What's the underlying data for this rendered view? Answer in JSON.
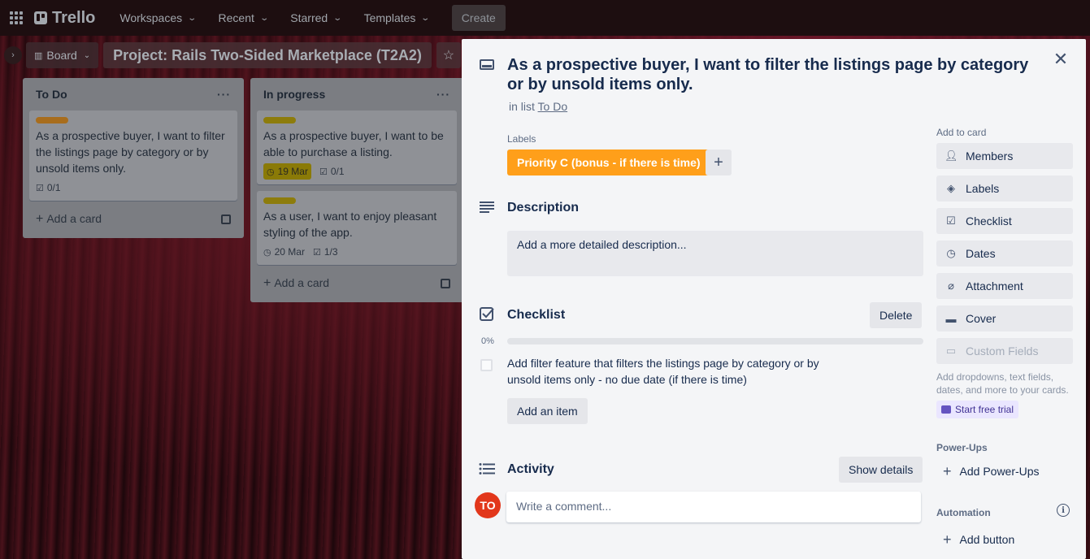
{
  "topnav": {
    "logo": "Trello",
    "items": [
      {
        "label": "Workspaces"
      },
      {
        "label": "Recent"
      },
      {
        "label": "Starred"
      },
      {
        "label": "Templates"
      }
    ],
    "create": "Create"
  },
  "boardbar": {
    "view": "Board",
    "title": "Project: Rails Two-Sided Marketplace (T2A2)"
  },
  "lists": [
    {
      "title": "To Do",
      "menu": "···",
      "cards": [
        {
          "label_color": "#d29034",
          "title": "As a prospective buyer, I want to filter the listings page by category or by unsold items only.",
          "checklist": "0/1"
        }
      ],
      "add_card": "Add a card"
    },
    {
      "title": "In progress",
      "menu": "···",
      "cards": [
        {
          "label_color": "#b39c10",
          "title": "As a prospective buyer, I want to be able to purchase a listing.",
          "due": "19 Mar",
          "checklist": "0/1"
        },
        {
          "label_color": "#b39c10",
          "title": "As a user, I want to enjoy pleasant styling of the app.",
          "due": "20 Mar",
          "checklist": "1/3"
        }
      ],
      "add_card": "Add a card"
    }
  ],
  "modal": {
    "title": "As a prospective buyer, I want to filter the listings page by category or by unsold items only.",
    "in_list_prefix": "in list",
    "in_list_name": "To Do",
    "labels_heading": "Labels",
    "label": {
      "text": "Priority C (bonus - if there is time)",
      "color": "#ff9f1a"
    },
    "description_heading": "Description",
    "description_placeholder": "Add a more detailed description...",
    "checklist_heading": "Checklist",
    "checklist_delete": "Delete",
    "checklist_progress_label": "0%",
    "checklist_progress": 0,
    "checklist_item": "Add filter feature that filters the listings page by category or by unsold items only - no due date (if there is time)",
    "add_item": "Add an item",
    "activity_heading": "Activity",
    "show_details": "Show details",
    "avatar_initials": "TO",
    "comment_placeholder": "Write a comment..."
  },
  "sidebar": {
    "add_to_card": "Add to card",
    "buttons": [
      {
        "label": "Members",
        "icon": "person-icon"
      },
      {
        "label": "Labels",
        "icon": "tag-icon"
      },
      {
        "label": "Checklist",
        "icon": "checklist-icon"
      },
      {
        "label": "Dates",
        "icon": "clock-icon"
      },
      {
        "label": "Attachment",
        "icon": "paperclip-icon"
      },
      {
        "label": "Cover",
        "icon": "cover-icon"
      },
      {
        "label": "Custom Fields",
        "icon": "custom-fields-icon"
      }
    ],
    "custom_fields_note": "Add dropdowns, text fields, dates, and more to your cards.",
    "start_trial": "Start free trial",
    "powerups_heading": "Power-Ups",
    "add_powerups": "Add Power-Ups",
    "automation_heading": "Automation",
    "add_button": "Add button"
  }
}
